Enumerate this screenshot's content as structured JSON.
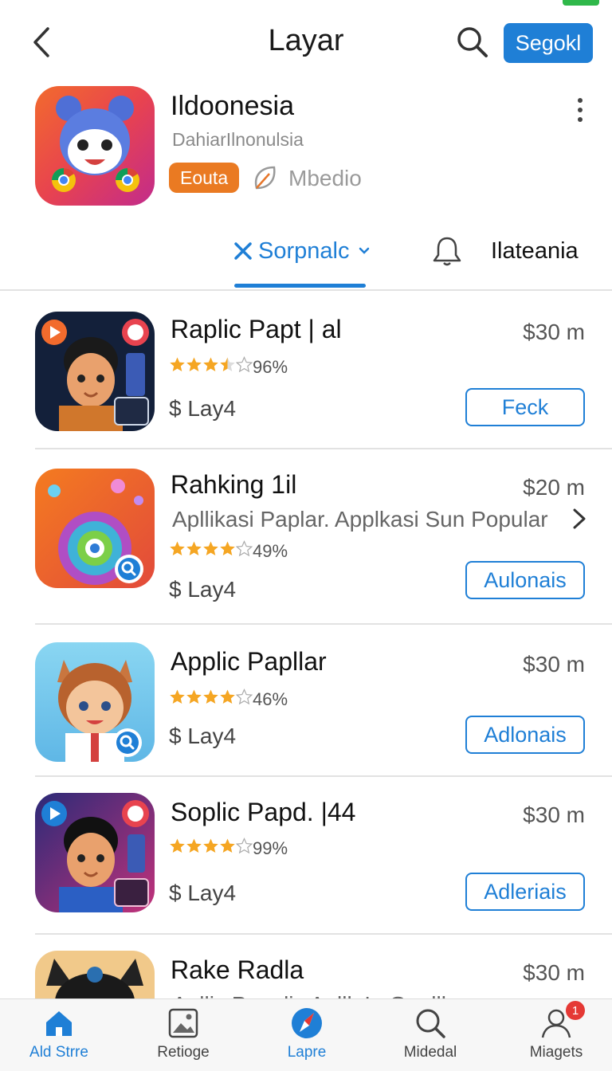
{
  "header": {
    "title": "Layar",
    "primary_button": "Segokl"
  },
  "app": {
    "name": "Ildoonesia",
    "developer": "DahiarIlnonulsia",
    "badge": "Eouta",
    "meta_label": "Mbedio"
  },
  "tabs": [
    {
      "label": "Sorpnalc",
      "active": true
    },
    {
      "label": "Ilateania",
      "active": false
    }
  ],
  "apps": [
    {
      "title": "Raplic Papt | al",
      "price": "$30 m",
      "rating_stars": 3.5,
      "rating_text": "96%",
      "cost": "$ Lay4",
      "action": "Feck",
      "description": null
    },
    {
      "title": "Rahking 1il",
      "price": "$20 m",
      "rating_stars": 4,
      "rating_text": "49%",
      "cost": "$ Lay4",
      "action": "Aulonais",
      "description": "Apllikasi Paplar. Applkasi Sun Popular"
    },
    {
      "title": "Applic Papllar",
      "price": "$30 m",
      "rating_stars": 4,
      "rating_text": "46%",
      "cost": "$ Lay4",
      "action": "Adlonais",
      "description": null
    },
    {
      "title": "Soplic Papd. |44",
      "price": "$30 m",
      "rating_stars": 4,
      "rating_text": "99%",
      "cost": "$ Lay4",
      "action": "Adleriais",
      "description": null
    },
    {
      "title": "Rake Radla",
      "price": "$30 m",
      "rating_stars": 0,
      "rating_text": "",
      "cost": "",
      "action": "",
      "description": "Apllic Papplic Apllk Ia Gapllk"
    }
  ],
  "bottom_nav": [
    {
      "label": "Ald Strre",
      "icon": "home-icon",
      "active": true
    },
    {
      "label": "Retioge",
      "icon": "image-icon",
      "active": false
    },
    {
      "label": "Lapre",
      "icon": "compass-icon",
      "active": true
    },
    {
      "label": "Midedal",
      "icon": "search-icon",
      "active": false
    },
    {
      "label": "Miagets",
      "icon": "profile-icon",
      "active": false,
      "badge": "1"
    }
  ],
  "colors": {
    "accent": "#1f7fd6",
    "badge_orange": "#ea7a22",
    "star": "#f5a623",
    "notification": "#e53935"
  }
}
